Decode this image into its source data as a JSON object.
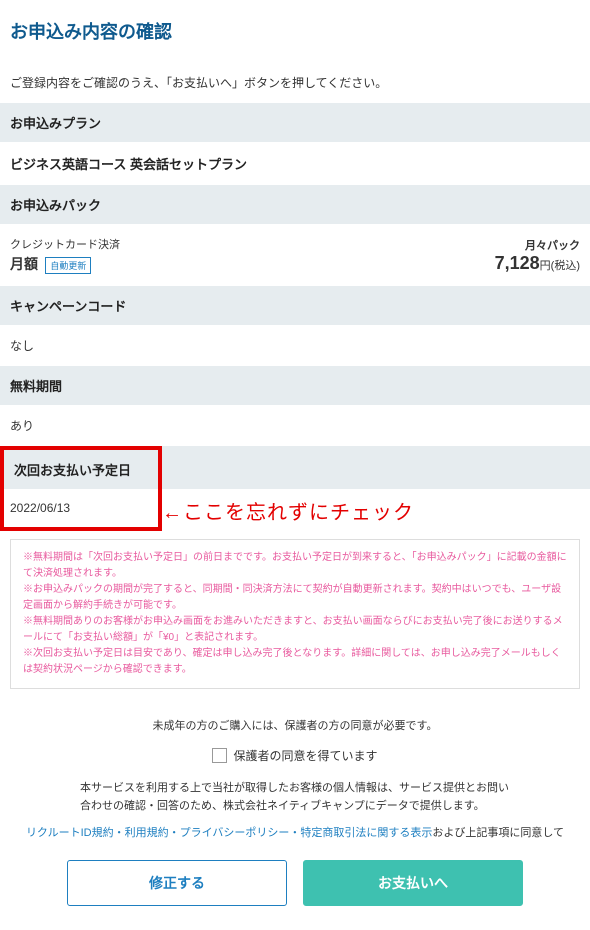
{
  "title": "お申込み内容の確認",
  "instruction": "ご登録内容をご確認のうえ、「お支払いへ」ボタンを押してください。",
  "sections": {
    "plan": {
      "header": "お申込みプラン",
      "value": "ビジネス英語コース 英会話セットプラン"
    },
    "pack": {
      "header": "お申込みパック",
      "pay_method": "クレジットカード決済",
      "monthly_label": "月額",
      "auto_renew": "自動更新",
      "pack_type": "月々パック",
      "price": "7,128",
      "price_suffix": "円(税込)"
    },
    "campaign": {
      "header": "キャンペーンコード",
      "value": "なし"
    },
    "free_period": {
      "header": "無料期間",
      "value": "あり"
    },
    "next_payment": {
      "header": "次回お支払い予定日",
      "value": "2022/06/13"
    }
  },
  "annotation": "←ここを忘れずにチェック",
  "notes": [
    "※無料期間は「次回お支払い予定日」の前日までです。お支払い予定日が到来すると、「お申込みパック」に記載の金額にて決済処理されます。",
    "※お申込みパックの期間が完了すると、同期間・同決済方法にて契約が自動更新されます。契約中はいつでも、ユーザ設定画面から解約手続きが可能です。",
    "※無料期間ありのお客様がお申込み画面をお進みいただきますと、お支払い画面ならびにお支払い完了後にお送りするメールにて「お支払い総額」が「¥0」と表記されます。",
    "※次回お支払い予定日は目安であり、確定は申し込み完了後となります。詳細に関しては、お申し込み完了メールもしくは契約状況ページから確認できます。"
  ],
  "consent": {
    "minor_notice": "未成年の方のご購入には、保護者の方の同意が必要です。",
    "checkbox_label": "保護者の同意を得ています",
    "service_notice": "本サービスを利用する上で当社が取得したお客様の個人情報は、サービス提供とお問い合わせの確認・回答のため、株式会社ネイティブキャンプにデータで提供します。",
    "links": {
      "recruit_id": "リクルートID規約",
      "terms": "利用規約",
      "privacy": "プライバシーポリシー",
      "commerce": "特定商取引法に関する表示",
      "suffix": "および上記事項に同意して"
    }
  },
  "buttons": {
    "modify": "修正する",
    "pay": "お支払いへ"
  }
}
